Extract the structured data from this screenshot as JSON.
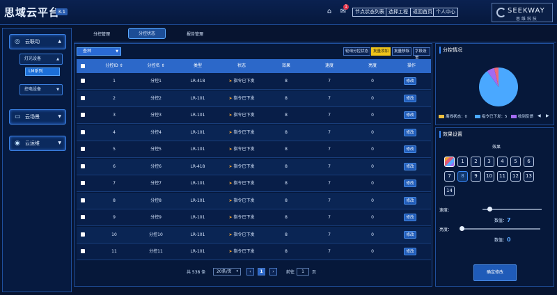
{
  "header": {
    "brand": "思域云平台",
    "version": "3.1",
    "notification_count": "1",
    "buttons": [
      "节点状态列表",
      "选择工程",
      "返回首页",
      "个人中心"
    ],
    "logo_text": "SEEKWAY",
    "logo_sub": "思 维 科 技"
  },
  "sidebar": {
    "groups": [
      {
        "icon": "◎",
        "label": "云联动"
      },
      {
        "icon": "▭",
        "label": "云场景"
      },
      {
        "icon": "◉",
        "label": "云运维"
      }
    ],
    "subs": [
      {
        "label": "灯光设备"
      },
      {
        "label": "控电设备"
      }
    ],
    "leaf": "LM系列"
  },
  "tabs": [
    "分控管理",
    "分控状态",
    "报告管理"
  ],
  "active_tab": 1,
  "toolbar": {
    "filter": "查林",
    "buttons": [
      "轮询分控状态",
      "批量添加",
      "批量移除",
      "字段设置"
    ],
    "highlight_index": 1
  },
  "table": {
    "columns": [
      "分控ID ⇕",
      "分控名 ⇕",
      "类型",
      "状态",
      "效果",
      "速度",
      "亮度",
      "操作"
    ],
    "rows": [
      {
        "id": "1",
        "name": "分控1",
        "type": "LR-418",
        "status": "指令已下发",
        "effect": "8",
        "speed": "7",
        "brightness": "0",
        "action": "修改"
      },
      {
        "id": "2",
        "name": "分控2",
        "type": "LR-101",
        "status": "指令已下发",
        "effect": "8",
        "speed": "7",
        "brightness": "0",
        "action": "修改"
      },
      {
        "id": "3",
        "name": "分控3",
        "type": "LR-101",
        "status": "指令已下发",
        "effect": "8",
        "speed": "7",
        "brightness": "0",
        "action": "修改"
      },
      {
        "id": "4",
        "name": "分控4",
        "type": "LR-101",
        "status": "指令已下发",
        "effect": "8",
        "speed": "7",
        "brightness": "0",
        "action": "修改"
      },
      {
        "id": "5",
        "name": "分控5",
        "type": "LR-101",
        "status": "指令已下发",
        "effect": "8",
        "speed": "7",
        "brightness": "0",
        "action": "修改"
      },
      {
        "id": "6",
        "name": "分控6",
        "type": "LR-418",
        "status": "指令已下发",
        "effect": "8",
        "speed": "7",
        "brightness": "0",
        "action": "修改"
      },
      {
        "id": "7",
        "name": "分控7",
        "type": "LR-101",
        "status": "指令已下发",
        "effect": "8",
        "speed": "7",
        "brightness": "0",
        "action": "修改"
      },
      {
        "id": "8",
        "name": "分控8",
        "type": "LR-101",
        "status": "指令已下发",
        "effect": "8",
        "speed": "7",
        "brightness": "0",
        "action": "修改"
      },
      {
        "id": "9",
        "name": "分控9",
        "type": "LR-101",
        "status": "指令已下发",
        "effect": "8",
        "speed": "7",
        "brightness": "0",
        "action": "修改"
      },
      {
        "id": "10",
        "name": "分控10",
        "type": "LR-101",
        "status": "指令已下发",
        "effect": "8",
        "speed": "7",
        "brightness": "0",
        "action": "修改"
      },
      {
        "id": "11",
        "name": "分控11",
        "type": "LR-101",
        "status": "指令已下发",
        "effect": "8",
        "speed": "7",
        "brightness": "0",
        "action": "修改"
      }
    ]
  },
  "pager": {
    "total": "共 538 条",
    "page_size": "20条/页",
    "prev": "‹",
    "current": "1",
    "next": "›",
    "goto_label": "前往",
    "goto_value": "1",
    "page_label": "页"
  },
  "status_panel": {
    "title": "分控情况",
    "legend": [
      {
        "label": "离线状态：0",
        "color": "#f0c040"
      },
      {
        "label": "指令已下发：5",
        "color": "#4aa8ff"
      },
      {
        "label": "收到反馈",
        "color": "#a36bf0"
      }
    ],
    "pie": [
      {
        "label": "离线状态",
        "value": 0,
        "color": "#f0c040"
      },
      {
        "label": "指令已下发",
        "value": 5,
        "color": "#4aa8ff"
      },
      {
        "label": "收到反馈",
        "value": 0.35,
        "color": "#a36bf0"
      },
      {
        "label": "other",
        "value": 0.2,
        "color": "#f06a7a"
      }
    ]
  },
  "effect_panel": {
    "title": "效果设置",
    "effect_label": "效果",
    "effects": [
      "",
      "1",
      "2",
      "3",
      "4",
      "5",
      "6",
      "7",
      "8",
      "9",
      "10",
      "11",
      "12",
      "13",
      "14"
    ],
    "selected": "8",
    "speed_label": "速度：",
    "speed_value_label": "数值：",
    "speed_value": "7",
    "speed_fraction": 0.12,
    "brightness_label": "亮度：",
    "brightness_value_label": "数值：",
    "brightness_value": "0",
    "brightness_fraction": 0.0,
    "confirm": "确定修改"
  }
}
